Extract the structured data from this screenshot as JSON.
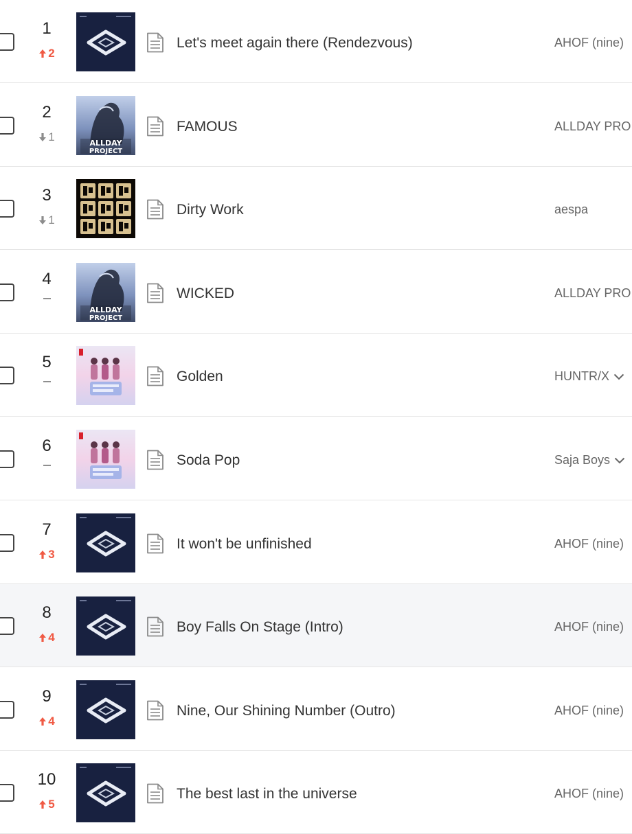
{
  "chart": {
    "rows": [
      {
        "rank": "1",
        "change": {
          "dir": "up",
          "amount": "2"
        },
        "title": "Let's meet again there (Rendezvous)",
        "artist": "AHOF (nine)",
        "art": "ahof",
        "more": false
      },
      {
        "rank": "2",
        "change": {
          "dir": "down",
          "amount": "1"
        },
        "title": "FAMOUS",
        "artist": "ALLDAY PRO",
        "art": "allday",
        "art_text": "ALLDAY PROJECT",
        "more": false
      },
      {
        "rank": "3",
        "change": {
          "dir": "down",
          "amount": "1"
        },
        "title": "Dirty Work",
        "artist": "aespa",
        "art": "aespa",
        "more": false
      },
      {
        "rank": "4",
        "change": {
          "dir": "same",
          "amount": ""
        },
        "title": "WICKED",
        "artist": "ALLDAY PRO",
        "art": "allday",
        "art_text": "ALLDAY PROJECT",
        "more": false
      },
      {
        "rank": "5",
        "change": {
          "dir": "same",
          "amount": ""
        },
        "title": "Golden",
        "artist": "HUNTR/X",
        "art": "kpop",
        "more": true
      },
      {
        "rank": "6",
        "change": {
          "dir": "same",
          "amount": ""
        },
        "title": "Soda Pop",
        "artist": "Saja Boys",
        "art": "kpop",
        "more": true
      },
      {
        "rank": "7",
        "change": {
          "dir": "up",
          "amount": "3"
        },
        "title": "It won't be unfinished",
        "artist": "AHOF (nine)",
        "art": "ahof",
        "more": false
      },
      {
        "rank": "8",
        "change": {
          "dir": "up",
          "amount": "4"
        },
        "title": "Boy Falls On Stage (Intro)",
        "artist": "AHOF (nine)",
        "art": "ahof",
        "more": false,
        "highlight": true
      },
      {
        "rank": "9",
        "change": {
          "dir": "up",
          "amount": "4"
        },
        "title": "Nine, Our Shining Number (Outro)",
        "artist": "AHOF (nine)",
        "art": "ahof",
        "more": false
      },
      {
        "rank": "10",
        "change": {
          "dir": "up",
          "amount": "5"
        },
        "title": "The best last in the universe",
        "artist": "AHOF (nine)",
        "art": "ahof",
        "more": false
      }
    ]
  },
  "colors": {
    "up": "#f05a44",
    "down": "#8c8c8c",
    "highlight_row": "#f5f6f8"
  },
  "icons": {
    "lyrics": "document-icon",
    "up": "arrow-up-icon",
    "down": "arrow-down-icon",
    "same": "dash-icon",
    "more": "chevron-down-icon"
  }
}
